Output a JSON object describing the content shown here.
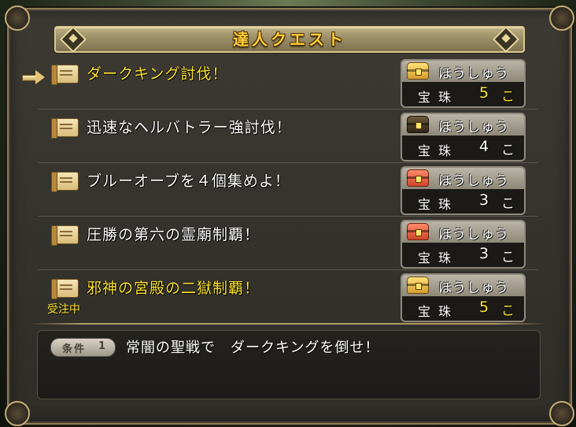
{
  "window": {
    "title": "達人クエスト"
  },
  "quests": [
    {
      "title": "ダークキング討伐！",
      "highlight": true,
      "status": "",
      "reward_label": "ほうしゅう",
      "reward_item": "宝珠",
      "reward_count": "5",
      "reward_unit": "こ",
      "chest": "gold",
      "reward_highlight": true
    },
    {
      "title": "迅速なヘルバトラー強討伐！",
      "highlight": false,
      "status": "",
      "reward_label": "ほうしゅう",
      "reward_item": "宝珠",
      "reward_count": "4",
      "reward_unit": "こ",
      "chest": "dark",
      "reward_highlight": false
    },
    {
      "title": "ブルーオーブを４個集めよ！",
      "highlight": false,
      "status": "",
      "reward_label": "ほうしゅう",
      "reward_item": "宝珠",
      "reward_count": "3",
      "reward_unit": "こ",
      "chest": "red",
      "reward_highlight": false
    },
    {
      "title": "圧勝の第六の霊廟制覇！",
      "highlight": false,
      "status": "",
      "reward_label": "ほうしゅう",
      "reward_item": "宝珠",
      "reward_count": "3",
      "reward_unit": "こ",
      "chest": "red",
      "reward_highlight": false
    },
    {
      "title": "邪神の宮殿の二獄制覇！",
      "highlight": true,
      "status": "受注中",
      "reward_label": "ほうしゅう",
      "reward_item": "宝珠",
      "reward_count": "5",
      "reward_unit": "こ",
      "chest": "gold",
      "reward_highlight": true
    }
  ],
  "condition": {
    "badge_label": "条件",
    "badge_number": "1",
    "text": "常闇の聖戦で　ダークキングを倒せ！"
  },
  "colors": {
    "highlight_text": "#ffe52c",
    "normal_text": "#ffffff",
    "title_text": "#ffcf3a"
  }
}
